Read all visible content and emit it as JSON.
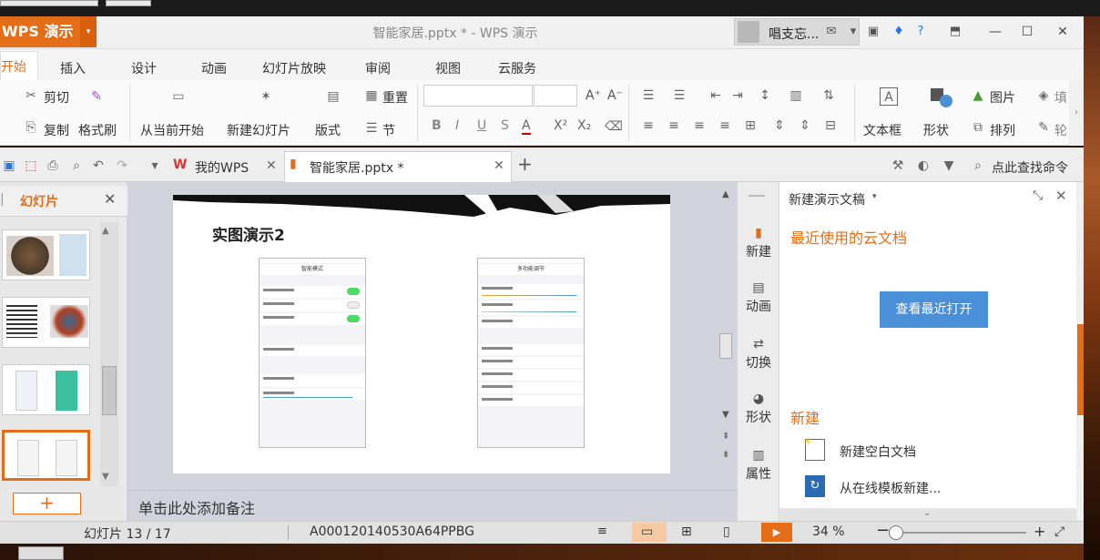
{
  "titlebar": {
    "app_name": "WPS 演示",
    "app_arrow": "▾",
    "doc_title": "智能家居.pptx * - WPS 演示",
    "user_name": "唱支忘...",
    "icons": [
      "mail-icon",
      "shirt-icon",
      "help-icon",
      "pin-icon"
    ],
    "min": "—",
    "max": "☐",
    "close": "✕"
  },
  "menu": {
    "active": "开始",
    "items": [
      "插入",
      "设计",
      "动画",
      "幻灯片放映",
      "审阅",
      "视图",
      "云服务"
    ]
  },
  "ribbon": {
    "cut": "剪切",
    "copy": "复制",
    "format_painter": "格式刷",
    "from_current": "从当前开始",
    "new_slide": "新建幻灯片",
    "layout": "版式",
    "reset": "重置",
    "section": "节",
    "font_bold": "B",
    "font_italic": "I",
    "font_underline": "U",
    "font_strike": "S",
    "font_color": "A",
    "superscript": "X²",
    "subscript": "X₂",
    "grow": "A⁺",
    "shrink": "A⁻",
    "textbox": "文本框",
    "shape": "形状",
    "picture": "图片",
    "arrange": "排列",
    "fill": "填",
    "outline": "轮"
  },
  "tabs": {
    "home": "我的WPS",
    "doc": "智能家居.pptx *",
    "close": "✕",
    "add": "+",
    "search_cmd": "点此查找命令"
  },
  "left_panel": {
    "tab_label": "幻灯片",
    "close": "✕",
    "add": "+"
  },
  "slide": {
    "title": "实图演示2",
    "phone_left_title": "智能模式",
    "phone_right_title": "多功能调节"
  },
  "notes": {
    "placeholder": "单击此处添加备注"
  },
  "side": {
    "new": "新建",
    "animation": "动画",
    "switch": "切换",
    "shape": "形状",
    "props": "属性"
  },
  "taskpane": {
    "header": "新建演示文稿",
    "recent_title": "最近使用的云文档",
    "recent_button": "查看最近打开",
    "new_title": "新建",
    "new_blank": "新建空白文档",
    "new_online": "从在线模板新建..."
  },
  "status": {
    "slide_counter": "幻灯片 13 / 17",
    "doc_id": "A000120140530A64PPBG",
    "zoom": "34 %",
    "zoom_level": 0.34,
    "slide_current": 13,
    "slide_total": 17
  },
  "colors": {
    "accent": "#e46d17",
    "blue_button": "#4a90d9",
    "canvas_bg": "#d1d4dc",
    "toggle_green": "#4cd964"
  }
}
